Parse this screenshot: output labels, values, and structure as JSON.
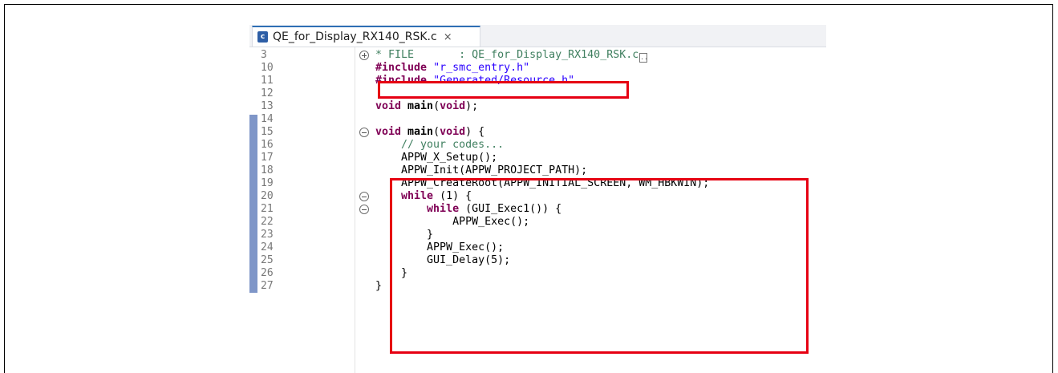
{
  "tab": {
    "icon_letter": "c",
    "filename": "QE_for_Display_RX140_RSK.c",
    "close_glyph": "×"
  },
  "lines": [
    {
      "n": "3",
      "fold": "plus",
      "segs": [
        {
          "t": "* FILE       : QE_for_Display_RX140_RSK.c",
          "c": "cmt"
        }
      ],
      "folded": true
    },
    {
      "n": "10",
      "fold": "",
      "segs": [
        {
          "t": "#include ",
          "c": "kw"
        },
        {
          "t": "\"r_smc_entry.h\"",
          "c": "str"
        }
      ]
    },
    {
      "n": "11",
      "fold": "",
      "segs": [
        {
          "t": "#include ",
          "c": "kw"
        },
        {
          "t": "\"Generated/Resource.h\"",
          "c": "str"
        }
      ]
    },
    {
      "n": "12",
      "fold": "",
      "segs": []
    },
    {
      "n": "13",
      "fold": "",
      "segs": [
        {
          "t": "void ",
          "c": "kw"
        },
        {
          "t": "main",
          "c": "fn"
        },
        {
          "t": "(",
          "c": ""
        },
        {
          "t": "void",
          "c": "kw"
        },
        {
          "t": ");",
          "c": ""
        }
      ]
    },
    {
      "n": "14",
      "fold": "",
      "segs": []
    },
    {
      "n": "15",
      "fold": "minus",
      "segs": [
        {
          "t": "void ",
          "c": "kw"
        },
        {
          "t": "main",
          "c": "fn"
        },
        {
          "t": "(",
          "c": ""
        },
        {
          "t": "void",
          "c": "kw"
        },
        {
          "t": ") {",
          "c": ""
        }
      ]
    },
    {
      "n": "16",
      "fold": "",
      "segs": [
        {
          "t": "    // your codes...",
          "c": "cmt"
        }
      ]
    },
    {
      "n": "17",
      "fold": "",
      "segs": [
        {
          "t": "    APPW_X_Setup();",
          "c": ""
        }
      ]
    },
    {
      "n": "18",
      "fold": "",
      "segs": [
        {
          "t": "    APPW_Init(APPW_PROJECT_PATH);",
          "c": ""
        }
      ]
    },
    {
      "n": "19",
      "fold": "",
      "segs": [
        {
          "t": "    APPW_CreateRoot(APPW_INITIAL_SCREEN, WM_HBKWIN);",
          "c": ""
        }
      ]
    },
    {
      "n": "20",
      "fold": "minus",
      "segs": [
        {
          "t": "    ",
          "c": ""
        },
        {
          "t": "while",
          "c": "kw"
        },
        {
          "t": " (1) {",
          "c": ""
        }
      ]
    },
    {
      "n": "21",
      "fold": "minus",
      "segs": [
        {
          "t": "        ",
          "c": ""
        },
        {
          "t": "while",
          "c": "kw"
        },
        {
          "t": " (GUI_Exec1()) {",
          "c": ""
        }
      ]
    },
    {
      "n": "22",
      "fold": "",
      "segs": [
        {
          "t": "            APPW_Exec();",
          "c": ""
        }
      ]
    },
    {
      "n": "23",
      "fold": "",
      "segs": [
        {
          "t": "        }",
          "c": ""
        }
      ]
    },
    {
      "n": "24",
      "fold": "",
      "segs": [
        {
          "t": "        APPW_Exec();",
          "c": ""
        }
      ]
    },
    {
      "n": "25",
      "fold": "",
      "segs": [
        {
          "t": "        GUI_Delay(5);",
          "c": ""
        }
      ]
    },
    {
      "n": "26",
      "fold": "",
      "segs": [
        {
          "t": "    }",
          "c": ""
        }
      ]
    },
    {
      "n": "27",
      "fold": "",
      "segs": [
        {
          "t": "}",
          "c": ""
        }
      ]
    }
  ],
  "colors": {
    "keyword": "#7f0055",
    "string": "#2a00ff",
    "comment": "#3f7f5f",
    "highlight": "#e60012",
    "ruler": "#7f96c8"
  }
}
